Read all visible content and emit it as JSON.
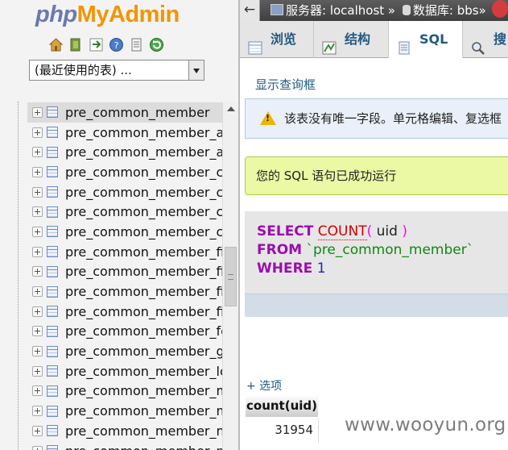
{
  "left": {
    "logo": {
      "php": "php",
      "my": "My",
      "admin": "Admin"
    },
    "nav_icons": [
      "home-icon",
      "exit-icon",
      "sql-query-icon",
      "help-icon",
      "docs-icon",
      "reload-icon"
    ],
    "db_select_value": "(最近使用的表) ...",
    "tables": [
      "pre_common_member",
      "pre_common_member_a",
      "pre_common_member_a",
      "pre_common_member_c",
      "pre_common_member_c",
      "pre_common_member_c",
      "pre_common_member_c",
      "pre_common_member_fi",
      "pre_common_member_fi",
      "pre_common_member_fi",
      "pre_common_member_fi",
      "pre_common_member_fc",
      "pre_common_member_g",
      "pre_common_member_lc",
      "pre_common_member_m",
      "pre_common_member_m",
      "pre_common_member_n",
      "pre_common_member_n"
    ]
  },
  "right": {
    "breadcrumb": {
      "back": "←",
      "server": "服务器: localhost »",
      "database": "数据库: bbs»"
    },
    "tabs": [
      {
        "label": "浏览",
        "icon": "browse-icon"
      },
      {
        "label": "结构",
        "icon": "structure-icon"
      },
      {
        "label": "SQL",
        "icon": "sql-icon"
      },
      {
        "label": "搜",
        "icon": "search-icon"
      }
    ],
    "show_query_link": "显示查询框",
    "notice": "该表没有唯一字段。单元格编辑、复选框",
    "success": "您的 SQL 语句已成功运行",
    "sql": {
      "select": "SELECT",
      "count": "COUNT",
      "lparen": "(",
      "col": " uid ",
      "rparen": ")",
      "from": "FROM",
      "table": "`pre_common_member`",
      "where": "WHERE",
      "value": "1"
    },
    "options_link": "+ 选项",
    "result_header": "count(uid)",
    "result_value": "31954"
  },
  "watermark": "www.wooyun.org"
}
